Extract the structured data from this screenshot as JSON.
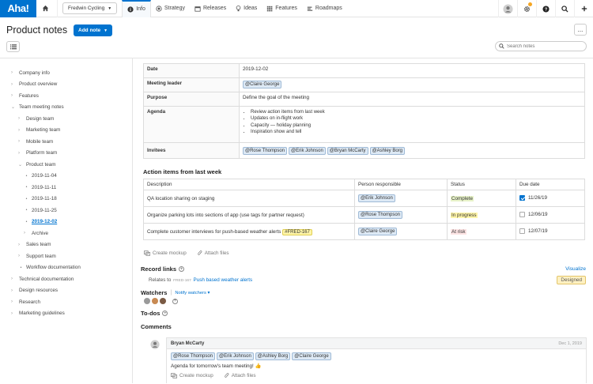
{
  "nav": {
    "logo": "Aha!",
    "workspace": "Fredwin Cycling",
    "tabs": [
      {
        "label": "Info",
        "icon": "info-icon"
      },
      {
        "label": "Strategy",
        "icon": "strategy-icon"
      },
      {
        "label": "Releases",
        "icon": "calendar-icon"
      },
      {
        "label": "Ideas",
        "icon": "lightbulb-icon"
      },
      {
        "label": "Features",
        "icon": "grid-icon"
      },
      {
        "label": "Roadmaps",
        "icon": "roadmap-icon"
      }
    ],
    "right_icons": [
      "avatar-icon",
      "gear-icon",
      "help-icon",
      "search-icon",
      "plus-icon"
    ],
    "accent": "#0073cf",
    "notification_color": "#f5a623"
  },
  "header": {
    "title": "Product notes",
    "add_note_label": "Add note",
    "more_label": "...",
    "search_placeholder": "Search notes"
  },
  "sidebar": {
    "items": [
      {
        "label": "Company info",
        "level": 0,
        "marker": "›"
      },
      {
        "label": "Product overview",
        "level": 0,
        "marker": "›"
      },
      {
        "label": "Features",
        "level": 0,
        "marker": "›"
      },
      {
        "label": "Team meeting notes",
        "level": 0,
        "marker": "⌄"
      },
      {
        "label": "Design team",
        "level": 1,
        "marker": "›"
      },
      {
        "label": "Marketing team",
        "level": 1,
        "marker": "›"
      },
      {
        "label": "Mobile team",
        "level": 1,
        "marker": "›"
      },
      {
        "label": "Platform team",
        "level": 1,
        "marker": "›"
      },
      {
        "label": "Product team",
        "level": 1,
        "marker": "⌄"
      },
      {
        "label": "2019-11-04",
        "level": 2,
        "marker": "•"
      },
      {
        "label": "2019-11-11",
        "level": 2,
        "marker": "•"
      },
      {
        "label": "2019-11-18",
        "level": 2,
        "marker": "•"
      },
      {
        "label": "2019-11-25",
        "level": 2,
        "marker": "•"
      },
      {
        "label": "2019-12-02",
        "level": 2,
        "marker": "•",
        "current": true
      },
      {
        "label": "Archive",
        "level": 2,
        "marker": "›"
      },
      {
        "label": "Sales team",
        "level": 1,
        "marker": "›"
      },
      {
        "label": "Support team",
        "level": 1,
        "marker": "›"
      },
      {
        "label": "Workflow documentation",
        "level": 1,
        "marker": "•"
      },
      {
        "label": "Technical documentation",
        "level": 0,
        "marker": "›"
      },
      {
        "label": "Design resources",
        "level": 0,
        "marker": "›"
      },
      {
        "label": "Research",
        "level": 0,
        "marker": "›"
      },
      {
        "label": "Marketing guidelines",
        "level": 0,
        "marker": "›"
      }
    ]
  },
  "details": {
    "date_label": "Date",
    "date_value": "2019-12-02",
    "leader_label": "Meeting leader",
    "leader_value": "@Claire George",
    "purpose_label": "Purpose",
    "purpose_value": "Define the goal of the meeting",
    "agenda_label": "Agenda",
    "agenda_items": [
      "Review action items from last week",
      "Updates on in-flight work",
      "Capacity — holiday planning",
      "Inspiration show and tell"
    ],
    "invitees_label": "Invitees",
    "invitees": [
      "@Rose Thompson",
      "@Erik Johnson",
      "@Bryan McCarty",
      "@Ashley Borg"
    ]
  },
  "actions": {
    "title": "Action items from last week",
    "columns": [
      "Description",
      "Person responsible",
      "Status",
      "Due date"
    ],
    "rows": [
      {
        "description": "QA location sharing on staging",
        "tag": "",
        "person": "@Erik Johnson",
        "status": "Complete",
        "status_type": "complete",
        "checked": true,
        "due": "11/26/19"
      },
      {
        "description": "Organize parking lots into sections of app (use tags for partner request)",
        "tag": "",
        "person": "@Rose Thompson",
        "status": "In progress",
        "status_type": "progress",
        "checked": false,
        "due": "12/06/19"
      },
      {
        "description": "Complete customer interviews for push-based weather alerts",
        "tag": "#FRED-167",
        "person": "@Claire George",
        "status": "At risk",
        "status_type": "risk",
        "checked": false,
        "due": "12/07/19"
      }
    ]
  },
  "attach": {
    "create_mockup": "Create mockup",
    "attach_files": "Attach files"
  },
  "record_links": {
    "title": "Record links",
    "visualize": "Visualize",
    "relates_to": "Relates to",
    "ref": "FRED-167",
    "link_text": "Push based weather alerts",
    "status": "Designed"
  },
  "watchers": {
    "title": "Watchers",
    "separator": "|",
    "notify": "Notify watchers ▾"
  },
  "todos": {
    "title": "To-dos"
  },
  "comments": {
    "title": "Comments",
    "author": "Bryan McCarty",
    "date": "Dec 1, 2019",
    "mentions": [
      "@Rose Thompson",
      "@Erik Johnson",
      "@Ashley Borg",
      "@Claire George"
    ],
    "text": "Agenda for tomorrow's team meeting! 👍",
    "create_mockup": "Create mockup",
    "attach_files": "Attach files"
  }
}
